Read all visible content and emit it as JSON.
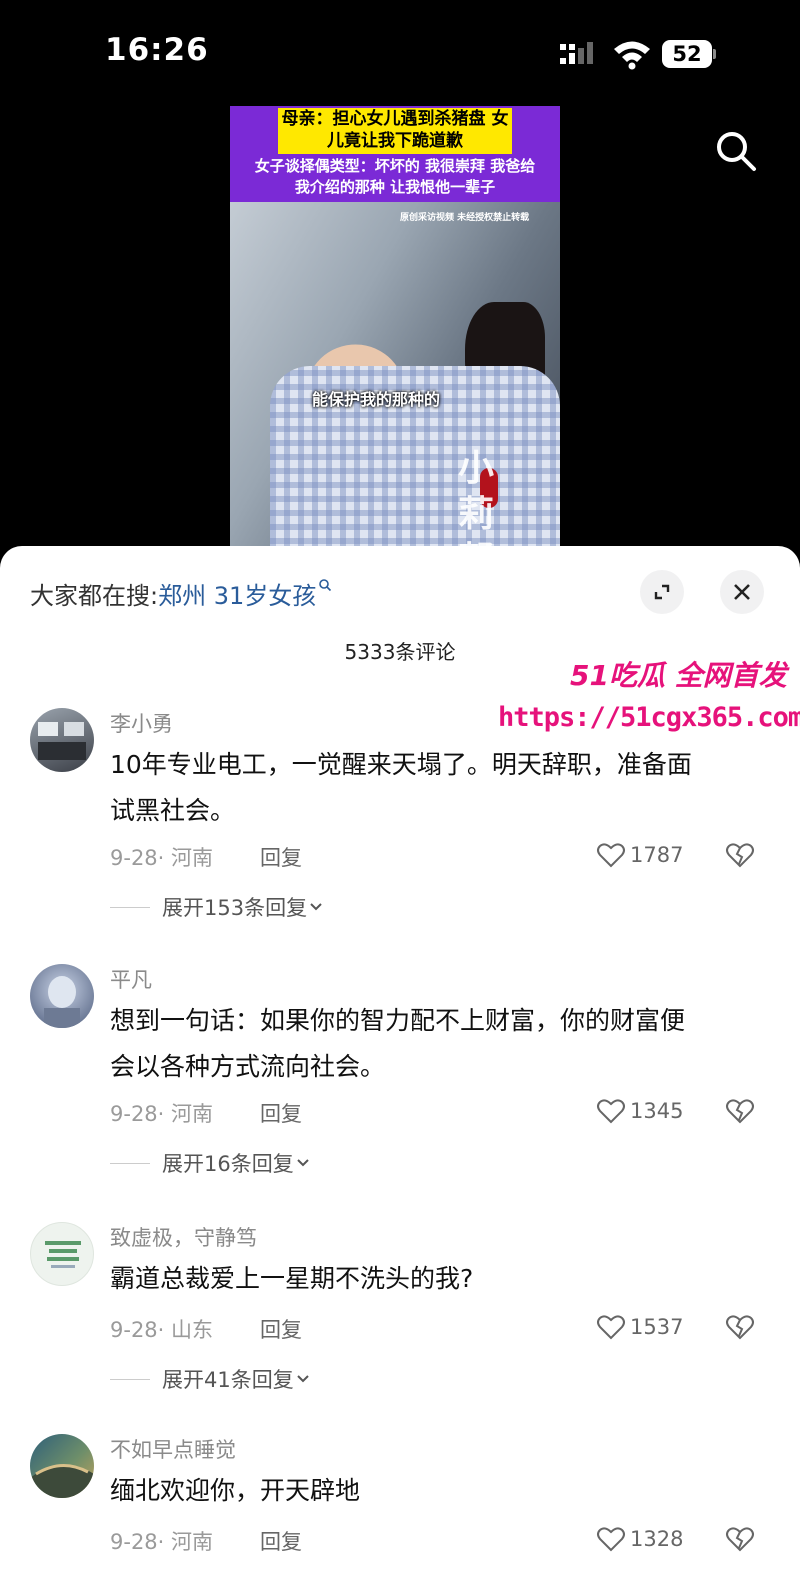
{
  "status_bar": {
    "time": "16:26",
    "battery": "52"
  },
  "video": {
    "headline_1": "母亲：担心女儿遇到杀猪盘 女儿竟让我下跪道歉",
    "headline_2": "女子谈择偶类型：坏坏的 我很崇拜 我爸给我介绍的那种 让我恨他一辈子",
    "copyright_note": "原创采访视频 未经授权禁止转载",
    "subtitle": "能保护我的那种的",
    "side_caption": "小莉帮忙"
  },
  "sheet": {
    "search_prefix": "大家都在搜:",
    "search_term": "郑州 31岁女孩",
    "comment_count": "5333条评论"
  },
  "promo": {
    "brand": "51吃瓜 全网首发",
    "url": "https://51cgx365.com"
  },
  "comments": [
    {
      "user": "李小勇",
      "text_line1": "10年专业电工，一觉醒来天塌了。明天辞职，准备面",
      "text_line2": "试黑社会。",
      "meta": "9-28· 河南",
      "reply": "回复",
      "likes": "1787",
      "expand": "展开153条回复"
    },
    {
      "user": "平凡",
      "text_line1": "想到一句话：如果你的智力配不上财富，你的财富便",
      "text_line2": "会以各种方式流向社会。",
      "meta": "9-28· 河南",
      "reply": "回复",
      "likes": "1345",
      "expand": "展开16条回复"
    },
    {
      "user": "致虚极，守静笃",
      "text_line1": "霸道总裁爱上一星期不洗头的我?",
      "meta": "9-28· 山东",
      "reply": "回复",
      "likes": "1537",
      "expand": "展开41条回复"
    },
    {
      "user": "不如早点睡觉",
      "text_line1": "缅北欢迎你，开天辟地",
      "meta": "9-28· 河南",
      "reply": "回复",
      "likes": "1328"
    }
  ]
}
